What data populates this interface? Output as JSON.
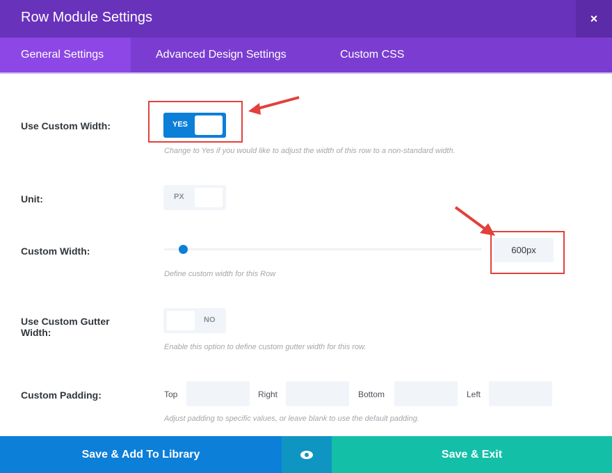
{
  "header": {
    "title": "Row Module Settings",
    "close": "×"
  },
  "tabs": [
    {
      "label": "General Settings",
      "active": true
    },
    {
      "label": "Advanced Design Settings"
    },
    {
      "label": "Custom CSS"
    }
  ],
  "fields": {
    "custom_width_toggle": {
      "label": "Use Custom Width:",
      "value": "YES",
      "description": "Change to Yes if you would like to adjust the width of this row to a non-standard width."
    },
    "unit": {
      "label": "Unit:",
      "value": "PX"
    },
    "custom_width": {
      "label": "Custom Width:",
      "value": "600px",
      "slider_fraction": 0.06,
      "description": "Define custom width for this Row"
    },
    "gutter": {
      "label": "Use Custom Gutter Width:",
      "value": "NO",
      "description": "Enable this option to define custom gutter width for this row."
    },
    "padding": {
      "label": "Custom Padding:",
      "top": "Top",
      "right": "Right",
      "bottom": "Bottom",
      "left": "Left",
      "top_value": "",
      "right_value": "",
      "bottom_value": "",
      "left_value": "",
      "description": "Adjust padding to specific values, or leave blank to use the default padding."
    }
  },
  "footer": {
    "library": "Save & Add To Library",
    "exit": "Save & Exit",
    "preview_icon": "eye-icon"
  },
  "colors": {
    "accent": "#0c7fd8",
    "header": "#6832bb",
    "annotation": "#e2403a",
    "teal": "#14bfa8"
  }
}
